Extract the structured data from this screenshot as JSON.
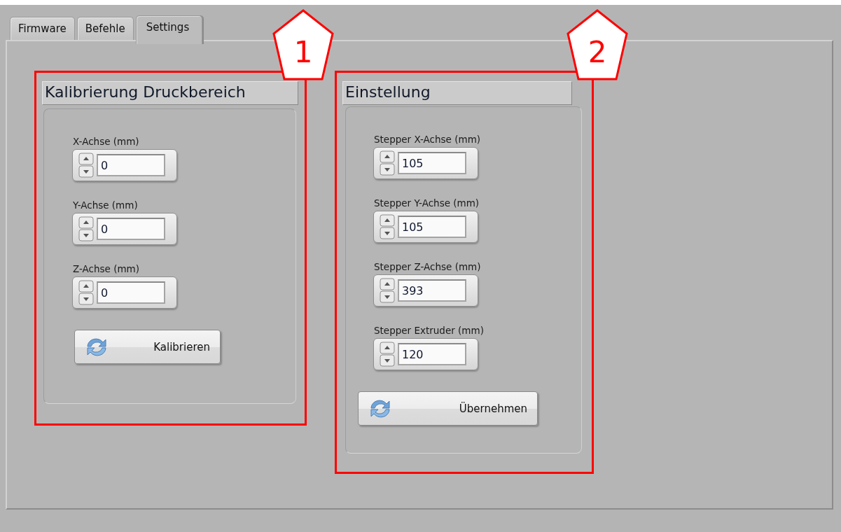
{
  "tabs": [
    {
      "label": "Firmware",
      "selected": false
    },
    {
      "label": "Befehle",
      "selected": false
    },
    {
      "label": "Settings",
      "selected": true
    }
  ],
  "groups": [
    {
      "callout": "1",
      "title": "Kalibrierung Druckbereich",
      "fields": [
        {
          "label": "X-Achse (mm)",
          "value": "0"
        },
        {
          "label": "Y-Achse (mm)",
          "value": "0"
        },
        {
          "label": "Z-Achse (mm)",
          "value": "0"
        }
      ],
      "button": "Kalibrieren"
    },
    {
      "callout": "2",
      "title": "Einstellung",
      "fields": [
        {
          "label": "Stepper X-Achse (mm)",
          "value": "105"
        },
        {
          "label": "Stepper Y-Achse (mm)",
          "value": "105"
        },
        {
          "label": "Stepper Z-Achse (mm)",
          "value": "393"
        },
        {
          "label": "Stepper Extruder (mm)",
          "value": "120"
        }
      ],
      "button": "Übernehmen"
    }
  ]
}
